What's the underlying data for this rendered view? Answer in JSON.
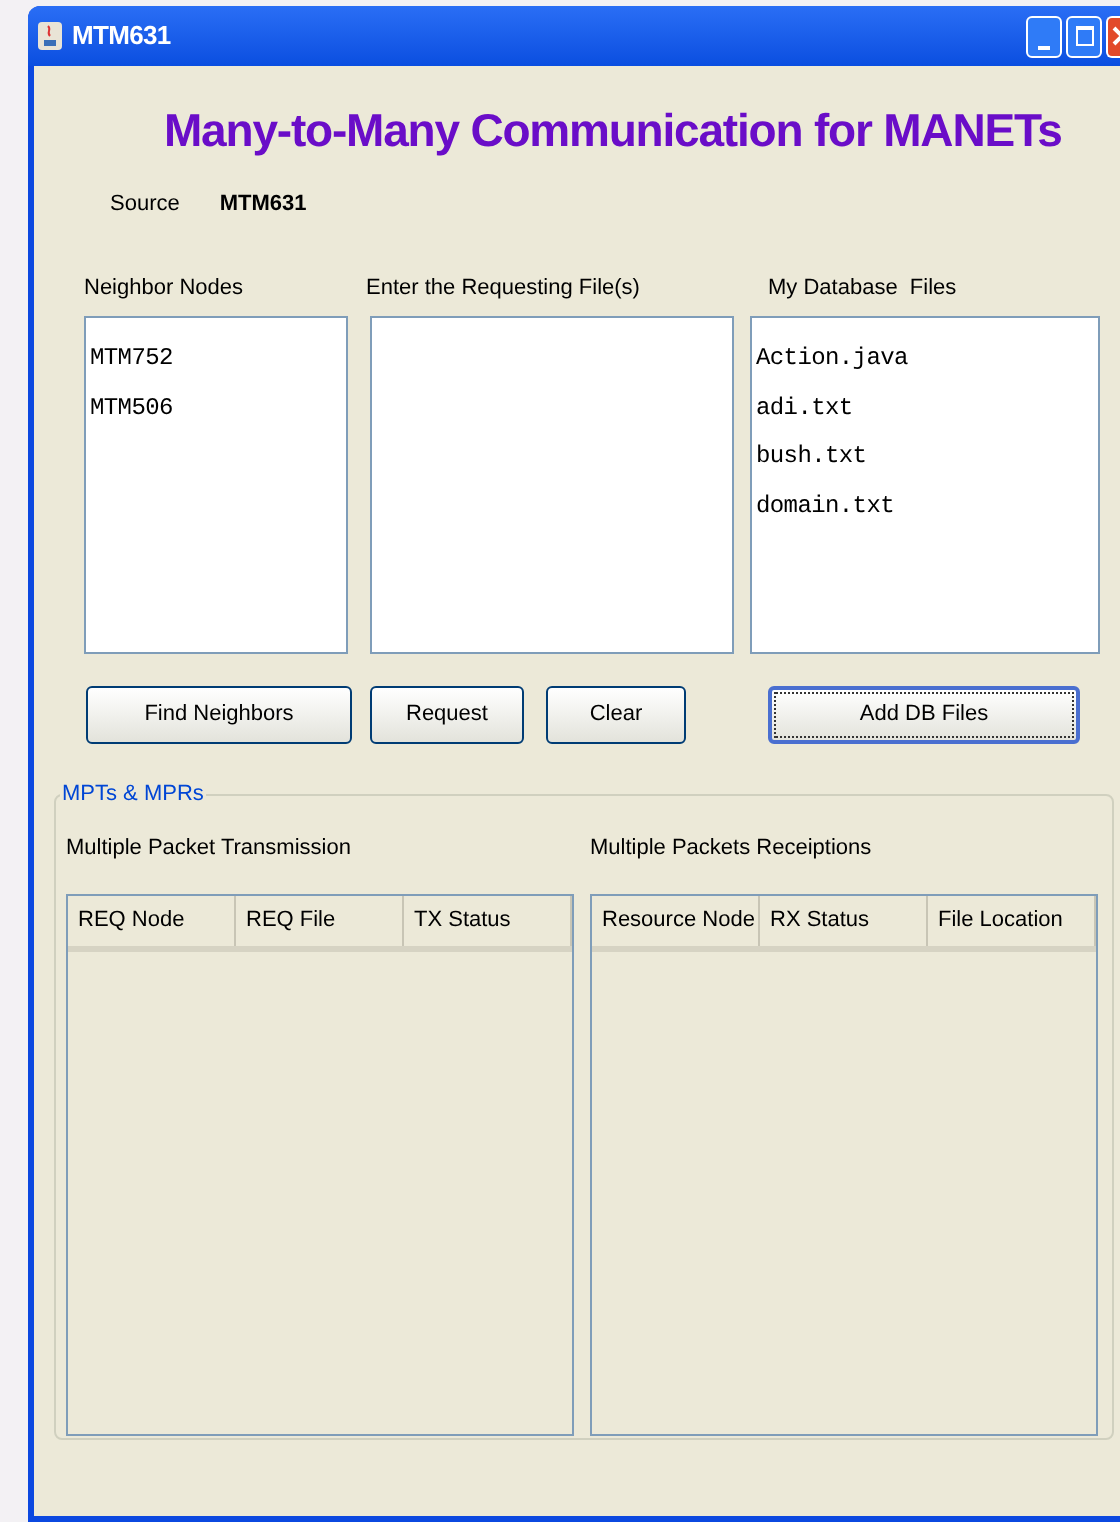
{
  "window": {
    "title": "MTM631"
  },
  "heading": "Many-to-Many Communication for MANETs",
  "source": {
    "label": "Source",
    "value": "MTM631"
  },
  "panels": [
    {
      "label": "Neighbor Nodes",
      "items": [
        "MTM752",
        "MTM506"
      ]
    },
    {
      "label": "Enter the Requesting File(s)"
    },
    {
      "label": "My Database  Files",
      "items": [
        "Action.java",
        "adi.txt",
        "bush.txt",
        "domain.txt"
      ]
    }
  ],
  "buttons": [
    {
      "label": "Find Neighbors",
      "focused": false
    },
    {
      "label": "Request",
      "focused": false
    },
    {
      "label": "Clear",
      "focused": false
    },
    {
      "label": "Add DB Files",
      "focused": true
    }
  ],
  "group": {
    "title": "MPTs & MPRs",
    "tables": [
      {
        "title": "Multiple Packet Transmission",
        "columns": [
          "REQ Node",
          "REQ File",
          "TX Status"
        ]
      },
      {
        "title": "Multiple Packets Receiptions",
        "columns": [
          "Resource Node",
          "RX Status",
          "File Location"
        ]
      }
    ]
  }
}
